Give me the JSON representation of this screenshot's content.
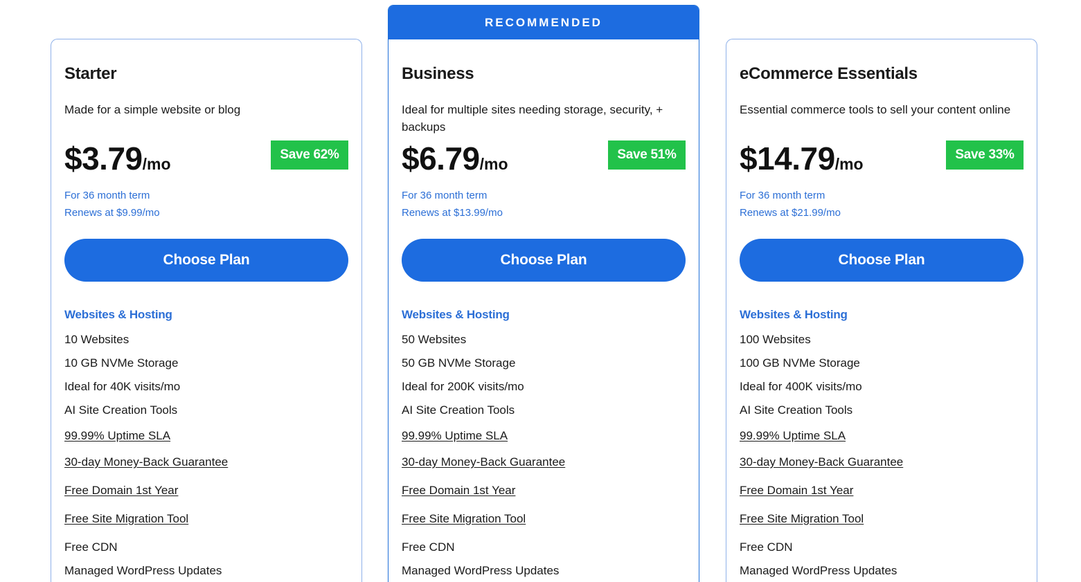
{
  "recommended_label": "RECOMMENDED",
  "plans": [
    {
      "name": "Starter",
      "description": "Made for a simple website or blog",
      "price": "$3.79",
      "per": "/mo",
      "save": "Save 62%",
      "term": "For 36 month term",
      "renews": "Renews at $9.99/mo",
      "cta": "Choose Plan",
      "section": "Websites & Hosting",
      "features": {
        "websites": "10 Websites",
        "storage": "10 GB NVMe Storage",
        "visits": "Ideal for 40K visits/mo",
        "ai_tools": "AI Site Creation Tools",
        "uptime": "99.99% Uptime SLA",
        "money_back": "30-day Money-Back Guarantee",
        "domain": "Free Domain 1st Year",
        "migration": "Free Site Migration Tool",
        "cdn": "Free CDN",
        "wp_updates": "Managed WordPress Updates"
      }
    },
    {
      "name": "Business",
      "description": "Ideal for multiple sites needing storage, security, + backups",
      "price": "$6.79",
      "per": "/mo",
      "save": "Save 51%",
      "term": "For 36 month term",
      "renews": "Renews at $13.99/mo",
      "cta": "Choose Plan",
      "section": "Websites & Hosting",
      "features": {
        "websites": "50 Websites",
        "storage": "50 GB NVMe Storage",
        "visits": "Ideal for 200K visits/mo",
        "ai_tools": "AI Site Creation Tools",
        "uptime": "99.99% Uptime SLA",
        "money_back": "30-day Money-Back Guarantee",
        "domain": "Free Domain 1st Year",
        "migration": "Free Site Migration Tool",
        "cdn": "Free CDN",
        "wp_updates": "Managed WordPress Updates"
      }
    },
    {
      "name": "eCommerce Essentials",
      "description": "Essential commerce tools to sell your content online",
      "price": "$14.79",
      "per": "/mo",
      "save": "Save 33%",
      "term": "For 36 month term",
      "renews": "Renews at $21.99/mo",
      "cta": "Choose Plan",
      "section": "Websites & Hosting",
      "features": {
        "websites": "100 Websites",
        "storage": "100 GB NVMe Storage",
        "visits": "Ideal for 400K visits/mo",
        "ai_tools": "AI Site Creation Tools",
        "uptime": "99.99% Uptime SLA",
        "money_back": "30-day Money-Back Guarantee",
        "domain": "Free Domain 1st Year",
        "migration": "Free Site Migration Tool",
        "cdn": "Free CDN",
        "wp_updates": "Managed WordPress Updates"
      }
    }
  ],
  "colors": {
    "brand_blue": "#1d6ce0",
    "link_blue": "#2c6fd6",
    "save_green": "#22c24a",
    "card_border": "#8fb1e9"
  }
}
